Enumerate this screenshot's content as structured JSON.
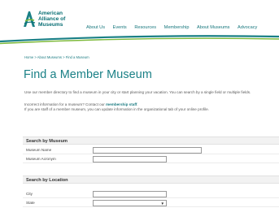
{
  "brand": {
    "name": "American Alliance of Museums",
    "line1": "American",
    "line2": "Alliance of",
    "line3": "Museums",
    "colors": {
      "teal": "#1a8086",
      "accent": "#7db93a",
      "dark_teal": "#0a6f75"
    }
  },
  "nav": {
    "items": [
      {
        "label": "About Us"
      },
      {
        "label": "Events"
      },
      {
        "label": "Resources"
      },
      {
        "label": "Membership"
      },
      {
        "label": "About Museums"
      },
      {
        "label": "Advocacy"
      }
    ]
  },
  "breadcrumb": "Home > About Museums > Find a Museum",
  "page": {
    "title": "Find a Member Museum",
    "intro": "Use our member directory to find a museum in your city or start planning your vacation. You can search by a single field or multiple fields.",
    "note_prefix": "Incorrect information for a museum? Contact our ",
    "note_link": "membership staff",
    "note_suffix": ".",
    "note_line2": "If you are staff of a member museum, you can update information in the organizational tab of your online profile."
  },
  "search_museum": {
    "heading": "Search by Museum",
    "name_label": "Museum Name",
    "name_value": "",
    "acronym_label": "Museum Acronym",
    "acronym_value": ""
  },
  "search_location": {
    "heading": "Search by Location",
    "city_label": "City",
    "city_value": "",
    "state_label": "State",
    "state_value": ""
  }
}
